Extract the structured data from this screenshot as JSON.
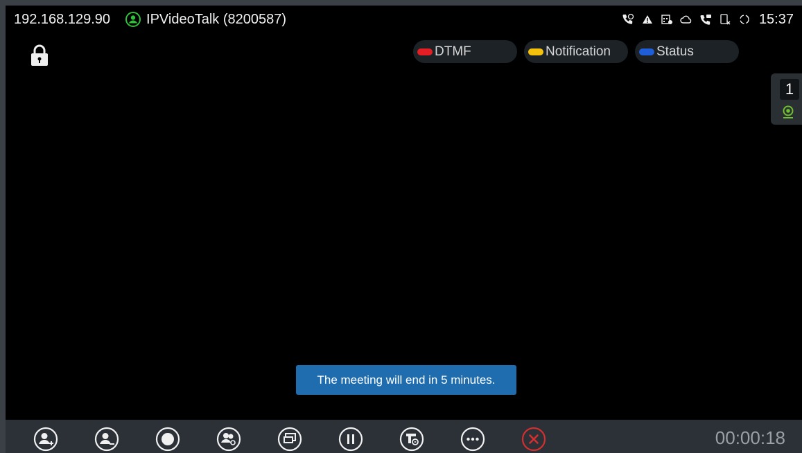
{
  "statusbar": {
    "ip": "192.168.129.90",
    "account": "IPVideoTalk (8200587)",
    "account_icon": "account-icon",
    "account_color": "#2fbf3a",
    "time": "15:37",
    "icons": [
      "call-forward-icon",
      "warning-icon",
      "calendar-icon",
      "cloud-icon",
      "voicemail-icon",
      "sim-off-icon",
      "sync-icon"
    ]
  },
  "lock_icon": "lock-icon",
  "pills": {
    "dtmf": {
      "label": "DTMF",
      "color": "#e31e24"
    },
    "notification": {
      "label": "Notification",
      "color": "#f4c20d"
    },
    "status": {
      "label": "Status",
      "color": "#1f5ed6"
    }
  },
  "participants": {
    "count": "1",
    "icon": "camera-icon",
    "color": "#6fc12f"
  },
  "toast": {
    "message": "The meeting will end in 5 minutes."
  },
  "controls": {
    "buttons": [
      "add-participant-icon",
      "remove-participant-icon",
      "record-icon",
      "layout-icon",
      "presentation-icon",
      "hold-icon",
      "video-icon",
      "more-icon",
      "end-call-icon"
    ],
    "end_color": "#d32f2f",
    "timer": "00:00:18"
  }
}
